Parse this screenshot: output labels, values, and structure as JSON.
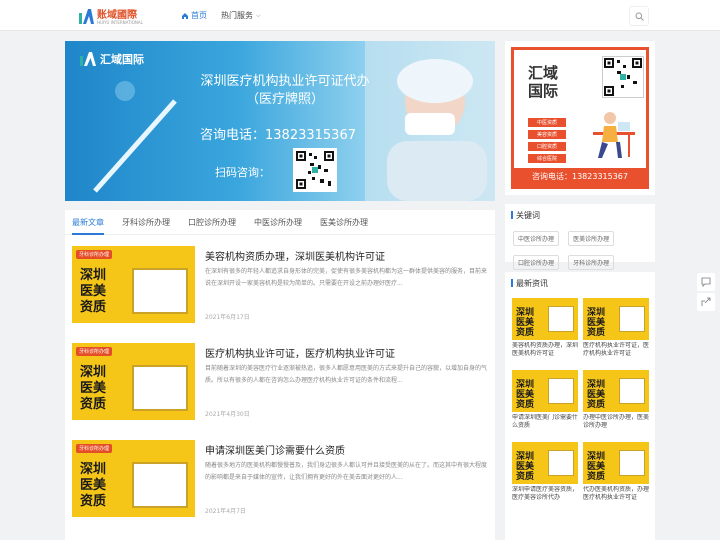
{
  "header": {
    "logo_text": "账域國際",
    "logo_sub": "HUIYU INTERNATIONAL",
    "nav": [
      {
        "label": "首页"
      },
      {
        "label": "热门服务"
      }
    ]
  },
  "banner": {
    "logo_text": "汇域国际",
    "title_line1": "深圳医疗机构执业许可证代办",
    "title_line2": "（医疗牌照）",
    "phone": "咨询电话：13823315367",
    "scan": "扫码咨询："
  },
  "tabs": [
    "最新文章",
    "牙科诊所办理",
    "口腔诊所办理",
    "中医诊所办理",
    "医美诊所办理"
  ],
  "thumb": {
    "tag": "牙科诊所办理",
    "line1": "深圳",
    "line2": "医美",
    "line3": "资质"
  },
  "articles": [
    {
      "title": "美容机构资质办理，深圳医美机构许可证",
      "desc": "在深圳有很多的年轻人都追求自身形体的完美，促使有很多美容机构都为这一群体提供美容的服务，目前来说在深圳开设一家美容机构是较为简单的。只需要在开设之前办理好医疗...",
      "date": "2021年6月17日"
    },
    {
      "title": "医疗机构执业许可证，医疗机构执业许可证",
      "desc": "目前随着深圳的美容医疗行业逐渐被热追，很多人都愿意用医美的方式来提升自己的容貌，以增加自身的气质。所以有很多的人都在咨询怎么办理医疗机构执业许可证的条件和流程...",
      "date": "2021年4月30日"
    },
    {
      "title": "申请深圳医美门诊需要什么资质",
      "desc": "随着很多地方的医美机构都慢慢普及，我们身边很多人都认可并且接受医美的从在了。而这其中有很大程度的影响都是来自于媒体的宣传，让我们拥有更好的外在美去面对更好的人...",
      "date": "2021年4月7日"
    }
  ],
  "sidebar_ad": {
    "title_line1": "汇域",
    "title_line2": "国际",
    "pills": [
      "中医资质",
      "美容资质",
      "口腔资质",
      "综合医院"
    ],
    "phone": "咨询电话：13823315367"
  },
  "keywords": {
    "heading": "关键词",
    "items": [
      "中医诊所办理",
      "医美诊所办理",
      "口腔诊所办理",
      "牙科诊所办理"
    ]
  },
  "news": {
    "heading": "最新资讯",
    "items": [
      {
        "caption": "美容机构资质办理，深圳医美机构许可证"
      },
      {
        "caption": "医疗机构执业许可证，医疗机构执业许可证"
      },
      {
        "caption": "申请深圳医美门诊需要什么资质"
      },
      {
        "caption": "办理中医诊所办理，医美诊所办理"
      },
      {
        "caption": "深圳申请医疗美容资质，医疗美容诊所代办"
      },
      {
        "caption": "代办医美机构资质，办理医疗机构执业许可证"
      }
    ]
  },
  "colors": {
    "accent": "#2b7bd6",
    "brand_red": "#e8502e",
    "thumb_yellow": "#f5c518"
  }
}
